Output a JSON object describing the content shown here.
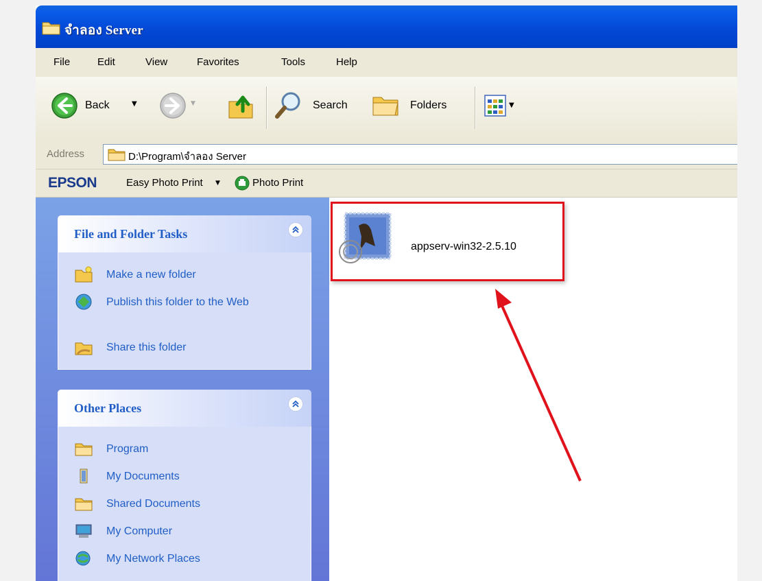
{
  "window": {
    "title": "จำลอง Server"
  },
  "menu": [
    "File",
    "Edit",
    "View",
    "Favorites",
    "Tools",
    "Help"
  ],
  "toolbar": {
    "back_label": "Back",
    "search_label": "Search",
    "folders_label": "Folders"
  },
  "address": {
    "label": "Address",
    "path": "D:\\Program\\จำลอง Server"
  },
  "epson": {
    "logo": "EPSON",
    "easy_photo_print": "Easy Photo Print",
    "photo_print": "Photo Print"
  },
  "file_tasks": {
    "title": "File and Folder Tasks",
    "items": [
      "Make a new folder",
      "Publish this folder to the Web",
      "Share this folder"
    ]
  },
  "other_places": {
    "title": "Other Places",
    "items": [
      "Program",
      "My Documents",
      "Shared Documents",
      "My Computer",
      "My Network Places"
    ]
  },
  "files": [
    {
      "name": "appserv-win32-2.5.10",
      "icon": "installer-stamp-icon"
    }
  ],
  "colors": {
    "titlebar": "#0a5be8",
    "task_link": "#215dc6",
    "highlight": "#e0121b",
    "arrow": "#e0121b"
  }
}
